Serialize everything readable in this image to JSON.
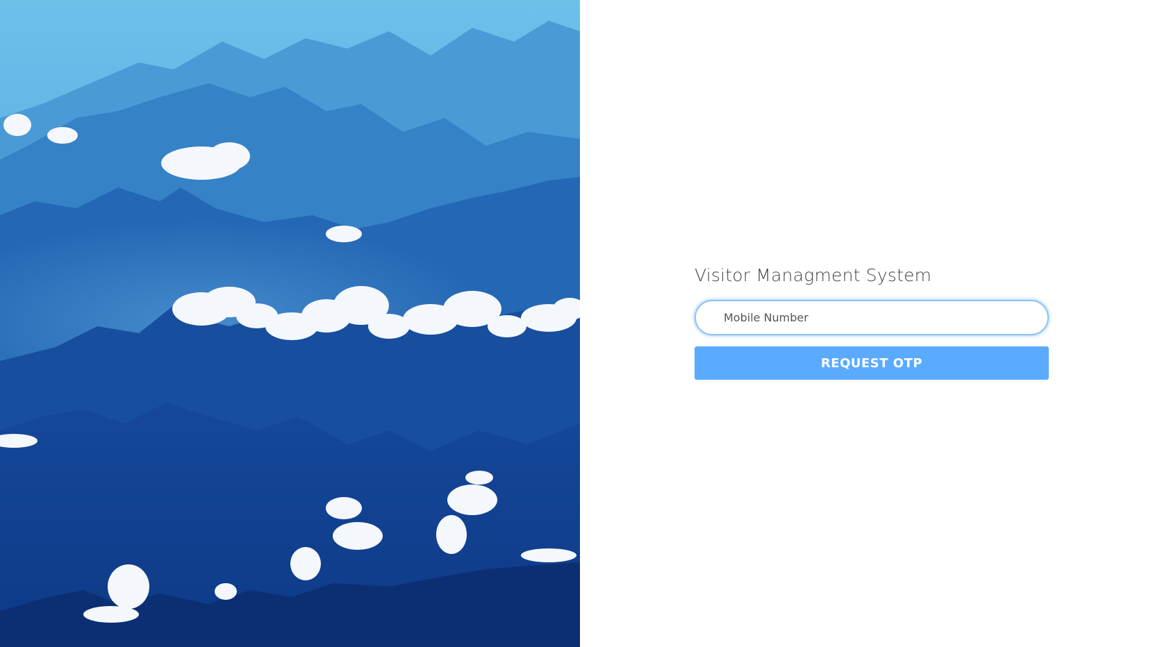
{
  "hero": {
    "image_name": "mountain-landscape-image",
    "colors": {
      "sky": "#5ab0e0",
      "far_ridge": "#3f8fcf",
      "mid_ridge": "#2a6db8",
      "near_ridge": "#144a9c",
      "front_ridge": "#0e3a88",
      "cloud": "#f4f8fc"
    }
  },
  "login": {
    "title": "Visitor Managment System",
    "mobile_input": {
      "placeholder": "Mobile Number",
      "value": ""
    },
    "request_otp_label": "REQUEST OTP"
  },
  "colors": {
    "accent": "#5aabff",
    "input_border": "#8fc3f5",
    "title_text": "#444444"
  }
}
